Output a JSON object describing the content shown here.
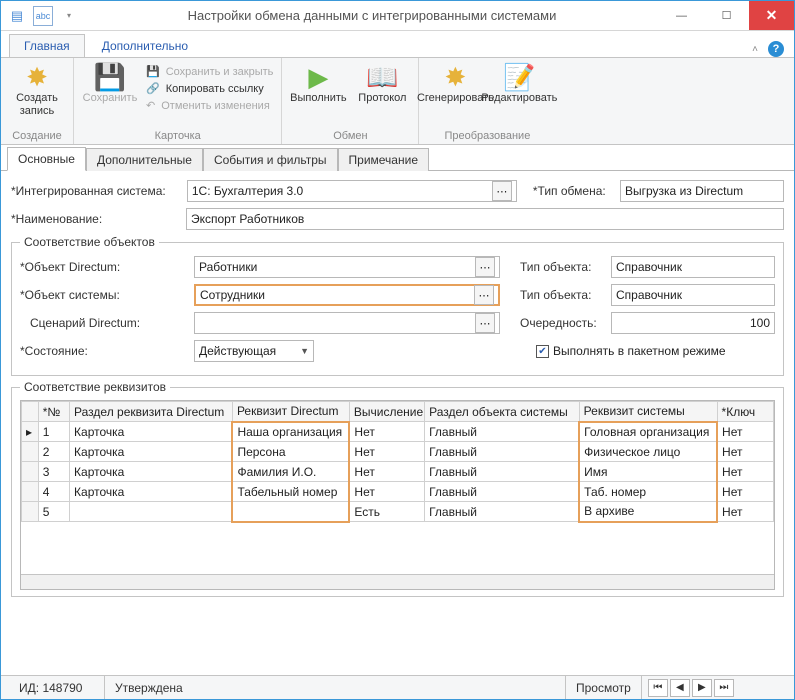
{
  "window": {
    "title": "Настройки обмена данными с интегрированными системами"
  },
  "ribbon": {
    "tabs": {
      "main": "Главная",
      "extra": "Дополнительно"
    },
    "create": {
      "big": "Создать\nзапись",
      "group": "Создание"
    },
    "card": {
      "save": "Сохранить",
      "save_close": "Сохранить и закрыть",
      "copy_link": "Копировать ссылку",
      "undo": "Отменить изменения",
      "group": "Карточка"
    },
    "exchange": {
      "run": "Выполнить",
      "protocol": "Протокол",
      "group": "Обмен"
    },
    "transform": {
      "generate": "Сгенерировать",
      "edit": "Редактировать",
      "group": "Преобразование"
    }
  },
  "lower_tabs": [
    "Основные",
    "Дополнительные",
    "События и фильтры",
    "Примечание"
  ],
  "form": {
    "int_system_label": "*Интегрированная система:",
    "int_system_value": "1С: Бухгалтерия 3.0",
    "exchange_type_label": "*Тип обмена:",
    "exchange_type_value": "Выгрузка из Directum",
    "name_label": "*Наименование:",
    "name_value": "Экспорт Работников",
    "fs_objects": "Соответствие объектов",
    "obj_dir_label": "*Объект Directum:",
    "obj_dir_value": "Работники",
    "obj_sys_label": "*Объект системы:",
    "obj_sys_value": "Сотрудники",
    "scen_label": "Сценарий Directum:",
    "scen_value": "",
    "type_obj_label": "Тип объекта:",
    "type_obj_value1": "Справочник",
    "type_obj_value2": "Справочник",
    "order_label": "Очередность:",
    "order_value": "100",
    "state_label": "*Состояние:",
    "state_value": "Действующая",
    "batch_label": "Выполнять в пакетном режиме",
    "fs_attrs": "Соответствие реквизитов"
  },
  "table": {
    "headers": {
      "num": "*№",
      "section": "Раздел реквизита Directum",
      "req": "Реквизит Directum",
      "calc": "Вычисление",
      "syssec": "Раздел объекта системы",
      "sysreq": "Реквизит системы",
      "key": "*Ключ"
    },
    "rows": [
      {
        "n": "1",
        "section": "Карточка",
        "req": "Наша организация",
        "calc": "Нет",
        "syssec": "Главный",
        "sysreq": "Головная организация",
        "key": "Нет"
      },
      {
        "n": "2",
        "section": "Карточка",
        "req": "Персона",
        "calc": "Нет",
        "syssec": "Главный",
        "sysreq": "Физическое лицо",
        "key": "Нет"
      },
      {
        "n": "3",
        "section": "Карточка",
        "req": "Фамилия И.О.",
        "calc": "Нет",
        "syssec": "Главный",
        "sysreq": "Имя",
        "key": "Нет"
      },
      {
        "n": "4",
        "section": "Карточка",
        "req": "Табельный номер",
        "calc": "Нет",
        "syssec": "Главный",
        "sysreq": "Таб. номер",
        "key": "Нет"
      },
      {
        "n": "5",
        "section": "",
        "req": "",
        "calc": "Есть",
        "syssec": "Главный",
        "sysreq": "В архиве",
        "key": "Нет"
      }
    ]
  },
  "status": {
    "id_label": "ИД:",
    "id_value": "148790",
    "state": "Утверждена",
    "preview": "Просмотр"
  }
}
